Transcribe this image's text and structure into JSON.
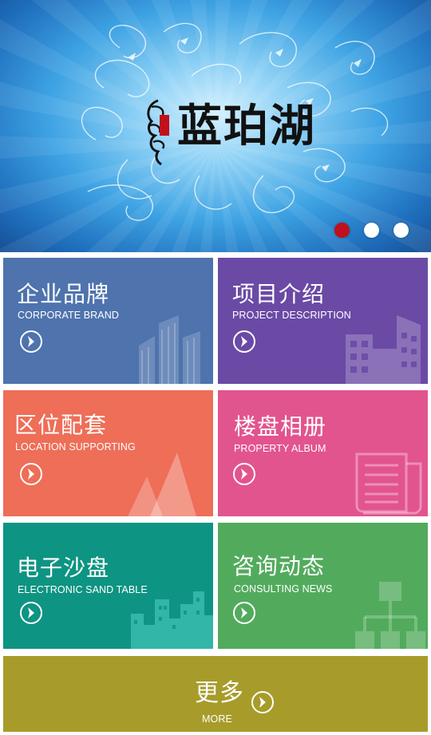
{
  "banner": {
    "brand_name": "蓝珀湖",
    "slides": 3,
    "active_slide": 1
  },
  "tiles": [
    {
      "id": "brand",
      "title_cn": "企业品牌",
      "title_en": "CORPORATE BRAND",
      "color": "#4e73ad",
      "icon": "buildings-icon"
    },
    {
      "id": "project",
      "title_cn": "项目介绍",
      "title_en": "PROJECT DESCRIPTION",
      "color": "#6a4aa5",
      "icon": "office-building-icon"
    },
    {
      "id": "location",
      "title_cn": "区位配套",
      "title_en": "LOCATION SUPPORTING",
      "color": "#ee6e58",
      "icon": "mountain-icon"
    },
    {
      "id": "album",
      "title_cn": "楼盘相册",
      "title_en": "PROPERTY ALBUM",
      "color": "#e2548e",
      "icon": "newspaper-icon"
    },
    {
      "id": "sand",
      "title_cn": "电子沙盘",
      "title_en": "ELECTRONIC SAND TABLE",
      "color": "#0e9482",
      "icon": "city-skyline-icon"
    },
    {
      "id": "news",
      "title_cn": "咨询动态",
      "title_en": "CONSULTING NEWS",
      "color": "#52ab5d",
      "icon": "org-chart-icon"
    }
  ],
  "more": {
    "title_cn": "更多",
    "title_en": "MORE",
    "color": "#a79c2a"
  }
}
